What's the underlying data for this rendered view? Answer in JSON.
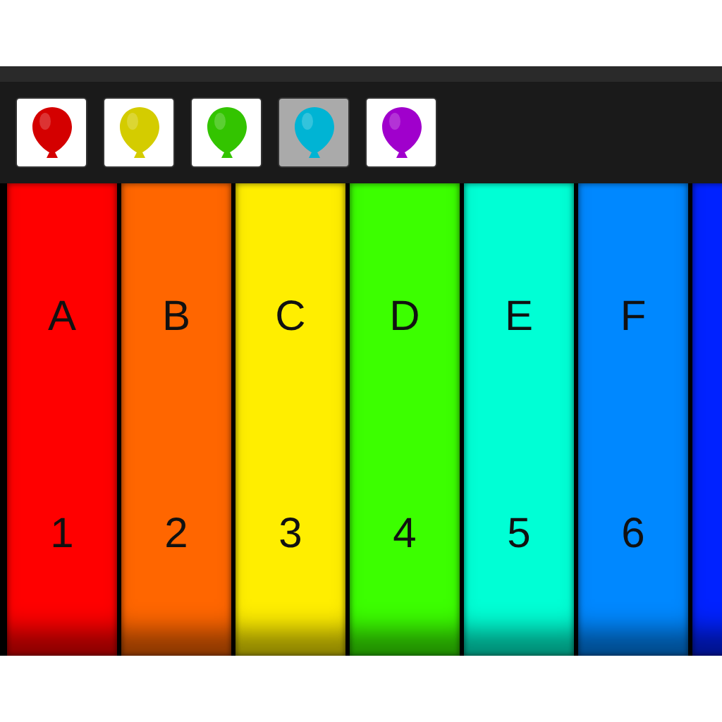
{
  "balloons": [
    {
      "color": "#d40000",
      "selected": false
    },
    {
      "color": "#d4cc00",
      "selected": false
    },
    {
      "color": "#33c400",
      "selected": false
    },
    {
      "color": "#00b4d4",
      "selected": true
    },
    {
      "color": "#a000cc",
      "selected": false
    }
  ],
  "keys": [
    {
      "color": "#ff0000",
      "note": "A",
      "number": "1"
    },
    {
      "color": "#ff6600",
      "note": "B",
      "number": "2"
    },
    {
      "color": "#ffee00",
      "note": "C",
      "number": "3"
    },
    {
      "color": "#3cff00",
      "note": "D",
      "number": "4"
    },
    {
      "color": "#00ffd5",
      "note": "E",
      "number": "5"
    },
    {
      "color": "#0088ff",
      "note": "F",
      "number": "6"
    },
    {
      "color": "#0022ff"
    }
  ]
}
